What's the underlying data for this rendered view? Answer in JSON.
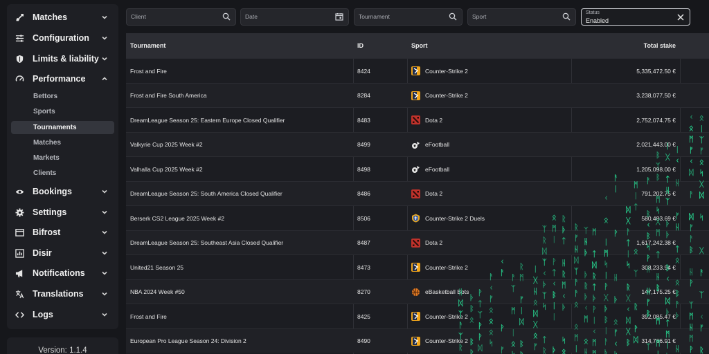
{
  "sidebar": {
    "items": [
      {
        "label": "Matches",
        "icon": "swords-icon",
        "expanded": false
      },
      {
        "label": "Configuration",
        "icon": "sliders-icon",
        "expanded": false
      },
      {
        "label": "Limits & liability",
        "icon": "shield-icon",
        "expanded": false
      },
      {
        "label": "Performance",
        "icon": "gauge-icon",
        "expanded": true
      },
      {
        "label": "Bookings",
        "icon": "eye-icon",
        "expanded": false
      },
      {
        "label": "Settings",
        "icon": "gear-icon",
        "expanded": false
      },
      {
        "label": "Bifrost",
        "icon": "bridge-icon",
        "expanded": false
      },
      {
        "label": "Disir",
        "icon": "chart-icon",
        "expanded": false
      },
      {
        "label": "Notifications",
        "icon": "megaphone-icon",
        "expanded": false
      },
      {
        "label": "Translations",
        "icon": "translate-icon",
        "expanded": false
      },
      {
        "label": "Logs",
        "icon": "code-icon",
        "expanded": false
      }
    ],
    "performance_sub": [
      {
        "label": "Bettors",
        "active": false
      },
      {
        "label": "Sports",
        "active": false
      },
      {
        "label": "Tournaments",
        "active": true
      },
      {
        "label": "Matches",
        "active": false
      },
      {
        "label": "Markets",
        "active": false
      },
      {
        "label": "Clients",
        "active": false
      }
    ],
    "version": "Version: 1.1.4"
  },
  "filters": {
    "client": {
      "placeholder": "Client"
    },
    "date": {
      "placeholder": "Date"
    },
    "tournament": {
      "placeholder": "Tournament"
    },
    "sport": {
      "placeholder": "Sport"
    },
    "status": {
      "caption": "Status",
      "value": "Enabled"
    }
  },
  "table": {
    "columns": {
      "tournament": "Tournament",
      "id": "ID",
      "sport": "Sport",
      "total_stake": "Total stake"
    },
    "rows": [
      {
        "tournament": "Frost and Fire",
        "id": "8424",
        "sport": "Counter-Strike 2",
        "sport_icon": "cs2",
        "total_stake": "5,335,472.50 €"
      },
      {
        "tournament": "Frost and Fire South America",
        "id": "8284",
        "sport": "Counter-Strike 2",
        "sport_icon": "cs2",
        "total_stake": "3,238,077.50 €"
      },
      {
        "tournament": "DreamLeague Season 25: Eastern Europe Closed Qualifier",
        "id": "8483",
        "sport": "Dota 2",
        "sport_icon": "dota2",
        "total_stake": "2,752,074.75 €"
      },
      {
        "tournament": "Valkyrie Cup 2025 Week #2",
        "id": "8499",
        "sport": "eFootball",
        "sport_icon": "efootball",
        "total_stake": "2,021,443.00 €"
      },
      {
        "tournament": "Valhalla Cup 2025 Week #2",
        "id": "8498",
        "sport": "eFootball",
        "sport_icon": "efootball",
        "total_stake": "1,205,098.00 €"
      },
      {
        "tournament": "DreamLeague Season 25: South America Closed Qualifier",
        "id": "8486",
        "sport": "Dota 2",
        "sport_icon": "dota2",
        "total_stake": "791,202.75 €"
      },
      {
        "tournament": "Berserk CS2 League 2025 Week #2",
        "id": "8506",
        "sport": "Counter-Strike 2 Duels",
        "sport_icon": "cs2duels",
        "total_stake": "580,483.69 €"
      },
      {
        "tournament": "DreamLeague Season 25: Southeast Asia Closed Qualifier",
        "id": "8487",
        "sport": "Dota 2",
        "sport_icon": "dota2",
        "total_stake": "1,617,242.38 €"
      },
      {
        "tournament": "United21 Season 25",
        "id": "8473",
        "sport": "Counter-Strike 2",
        "sport_icon": "cs2",
        "total_stake": "308,233.94 €"
      },
      {
        "tournament": "NBA 2024 Week #50",
        "id": "8270",
        "sport": "eBasketball Bots",
        "sport_icon": "ebasketball",
        "total_stake": "147,175.25 €"
      },
      {
        "tournament": "Frost and Fire",
        "id": "8425",
        "sport": "Counter-Strike 2",
        "sport_icon": "cs2",
        "total_stake": "392,085.47 €"
      },
      {
        "tournament": "European Pro League Season 24: Division 2",
        "id": "8490",
        "sport": "Counter-Strike 2",
        "sport_icon": "cs2",
        "total_stake": "314,766.91 €"
      }
    ]
  },
  "overlay": {
    "rune_color": "#27d08d"
  }
}
